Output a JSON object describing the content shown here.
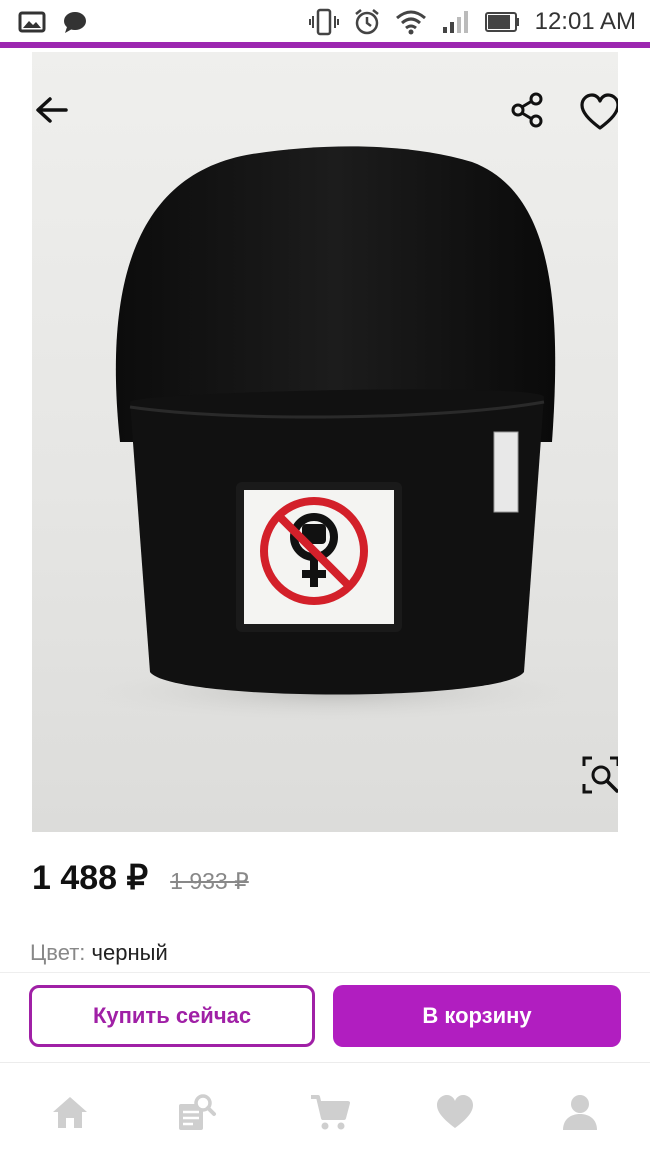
{
  "status_bar": {
    "time": "12:01 AM",
    "icons": [
      "gallery-icon",
      "message-icon",
      "vibrate-icon",
      "alarm-icon",
      "wifi-icon",
      "signal-icon",
      "battery-icon"
    ]
  },
  "product": {
    "price": "1 488 ₽",
    "old_price": "1 933 ₽",
    "color_label": "Цвет:",
    "color_value": "черный"
  },
  "actions": {
    "buy_now_label": "Купить сейчас",
    "add_to_cart_label": "В корзину"
  },
  "colors": {
    "accent": "#b11ec0",
    "accent_dark": "#a020a6",
    "status_accent": "#9c27b0",
    "nav_icon": "#cfcfcf"
  },
  "top_icons": [
    "back-arrow-icon",
    "share-icon",
    "heart-icon",
    "zoom-search-icon"
  ],
  "bottom_nav": {
    "items": [
      "home-icon",
      "catalog-search-icon",
      "cart-icon",
      "favorites-heart-icon",
      "profile-icon"
    ]
  }
}
